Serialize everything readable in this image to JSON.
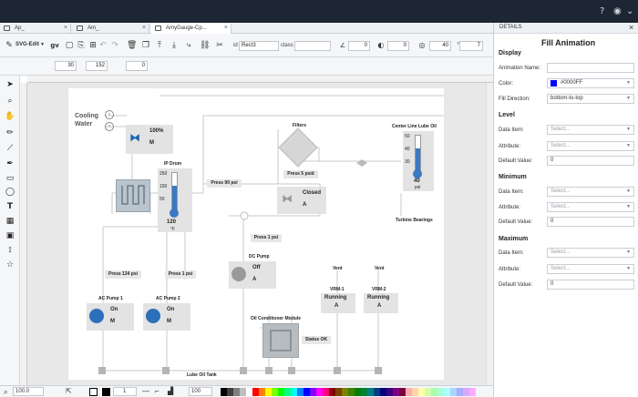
{
  "header": {
    "help_icon": "help-icon",
    "eye_icon": "eye-icon",
    "dropdown_icon": "chevron-down-icon"
  },
  "tabs": [
    {
      "label": "Ap_"
    },
    {
      "label": "Am_"
    },
    {
      "label": "AmyGauge-Cp..."
    }
  ],
  "toolbar": {
    "mode_label": "SVG-Edit",
    "id_label": "id",
    "id_value": "Rect3",
    "class_label": "class",
    "class_value": "",
    "angle_value": "0",
    "blur_value": "0",
    "opacity_value": "40",
    "round_value": "7"
  },
  "toolbar2": {
    "x_value": "30",
    "y_value": "152",
    "w_value": "0"
  },
  "status": {
    "zoom_value": "100.0",
    "stroke_value": "1",
    "opacity_value": "100"
  },
  "palette_colors": [
    "#000000",
    "#3f3f3f",
    "#7f7f7f",
    "#bfbfbf",
    "#ffffff",
    "#ff0000",
    "#ff7f00",
    "#ffff00",
    "#7fff00",
    "#00ff00",
    "#00ff7f",
    "#00ffff",
    "#007fff",
    "#0000ff",
    "#7f00ff",
    "#ff00ff",
    "#ff007f",
    "#7f0000",
    "#7f3f00",
    "#7f7f00",
    "#3f7f00",
    "#007f00",
    "#007f3f",
    "#007f7f",
    "#003f7f",
    "#00007f",
    "#3f007f",
    "#7f007f",
    "#7f003f",
    "#ffaaaa",
    "#ffd4aa",
    "#ffffaa",
    "#d4ffaa",
    "#aaffaa",
    "#aaffd4",
    "#aaffff",
    "#aad4ff",
    "#aaaaff",
    "#d4aaff",
    "#ffaaff"
  ],
  "diagram": {
    "cooling_water": "Cooling\nWater",
    "cooling_pct": "100%",
    "cooling_unit": "M",
    "ip_drum": "IP Drum",
    "ip_drum_ticks": [
      "250",
      "150",
      "50"
    ],
    "ip_drum_value": "120",
    "ip_drum_unit": "°F",
    "press_90": "Press 90 psi",
    "press_1_top": "Press 1 psi",
    "press_134": "Press 134 psi",
    "press_1_left": "Press 1 psi",
    "press_5": "Press 5 psid",
    "filters": "Filters",
    "closed": "Closed",
    "closed_unit": "A",
    "center_line": "Center Line Lube Oil",
    "center_ticks": [
      "50",
      "40",
      "30"
    ],
    "center_value": "40",
    "center_unit": "psi",
    "turbine_bearings": "Turbine Bearings",
    "ac_pump1": "AC Pump 1",
    "ac_pump1_state": "On",
    "ac_pump1_unit": "M",
    "ac_pump2": "AC Pump 2",
    "ac_pump2_state": "On",
    "ac_pump2_unit": "M",
    "dc_pump": "DC Pump",
    "dc_pump_state": "Off",
    "dc_pump_unit": "A",
    "vent1": "Vent",
    "vent2": "Vent",
    "vrm1": "VRM-1",
    "vrm1_state": "Running",
    "vrm1_unit": "A",
    "vrm2": "VRM-2",
    "vrm2_state": "Running",
    "vrm2_unit": "A",
    "oil_conditioner": "Oil Conditioner Module",
    "status_ok": "Status OK",
    "lube_oil_tank": "Lube Oil Tank"
  },
  "panel": {
    "title": "DETAILS",
    "heading": "Fill Animation",
    "display": "Display",
    "animation_name_label": "Animation Name:",
    "animation_name_value": "",
    "color_label": "Color:",
    "color_value": "#0000FF",
    "fill_direction_label": "Fill Direction:",
    "fill_direction_value": "bottom-to-top",
    "level": "Level",
    "minimum": "Minimum",
    "maximum": "Maximum",
    "data_item_label": "Data Item:",
    "attribute_label": "Attribute:",
    "default_value_label": "Default Value:",
    "select_placeholder": "Select...",
    "level_default": "0",
    "min_default": "0",
    "max_default": "0"
  }
}
